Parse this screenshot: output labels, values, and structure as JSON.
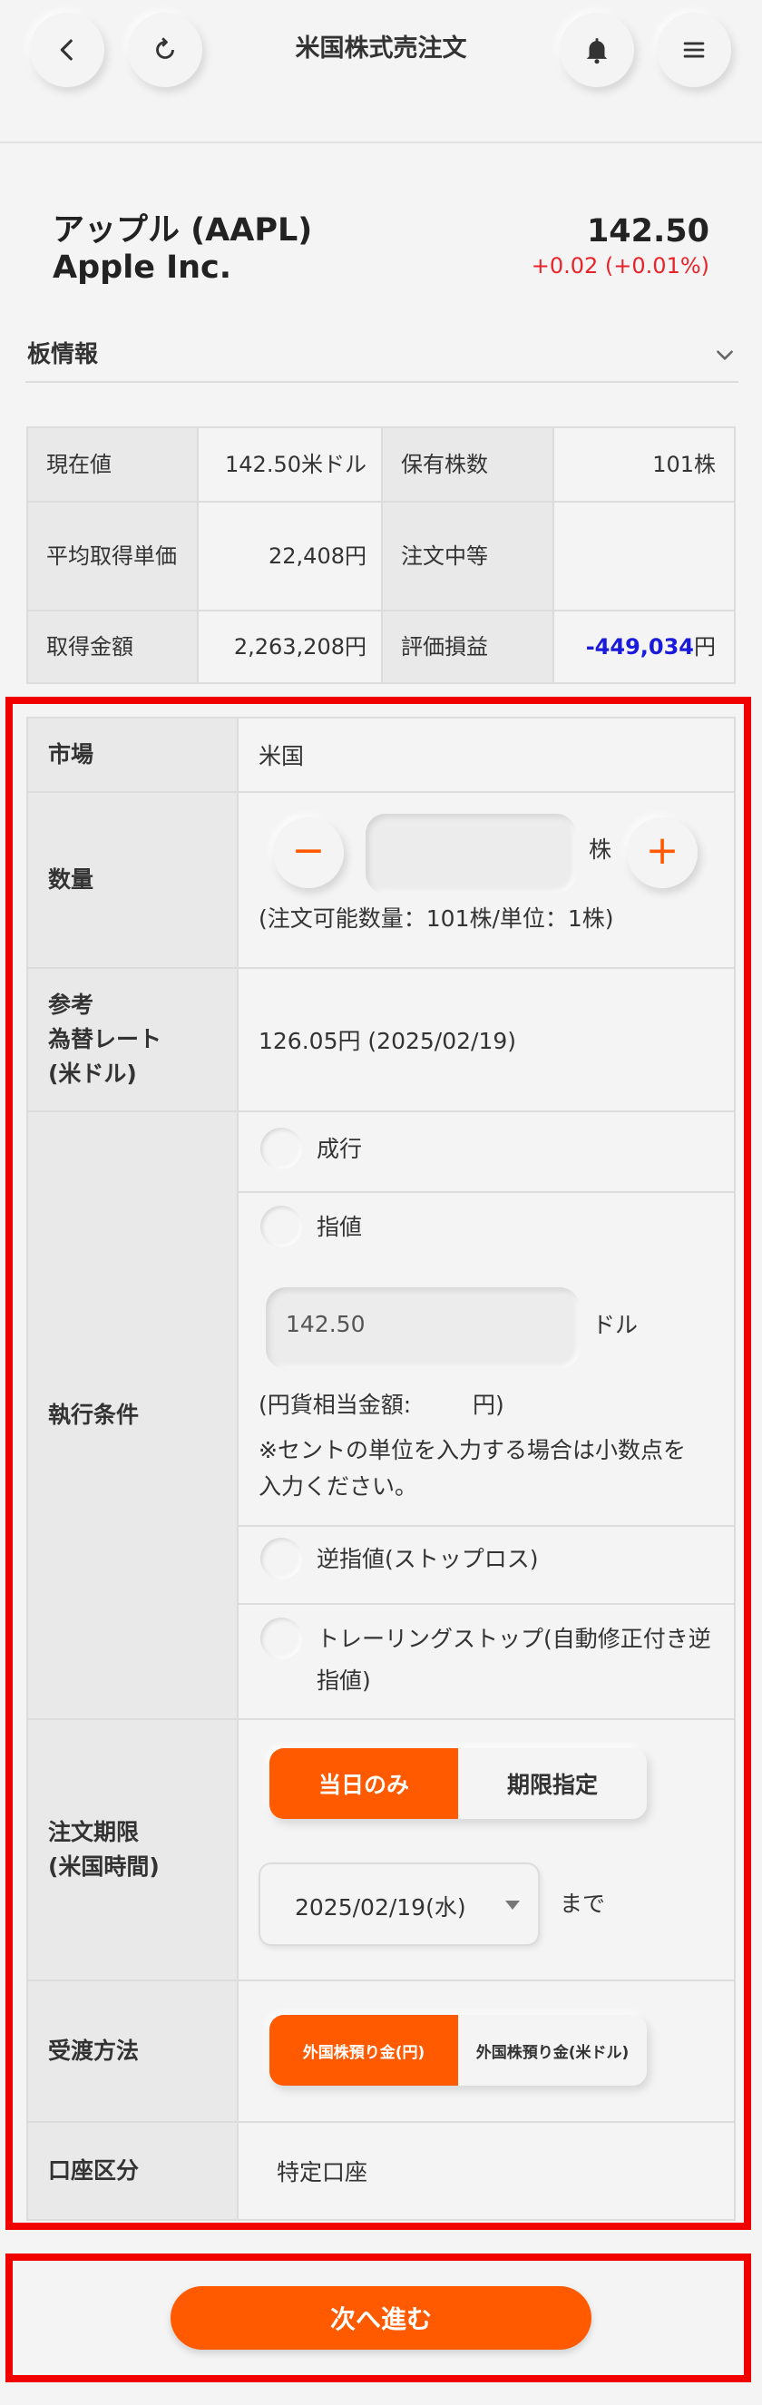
{
  "header": {
    "title": "米国株式売注文",
    "back_icon": "chevron-left-icon",
    "refresh_icon": "refresh-icon",
    "bell_icon": "bell-icon",
    "menu_icon": "hamburger-menu-icon"
  },
  "stock": {
    "name": "アップル (AAPL)",
    "sub": "Apple Inc.",
    "price": "142.50",
    "change": "+0.02",
    "change_pct": "(+0.01%)"
  },
  "board": {
    "label": "板情報"
  },
  "info_table": {
    "rows": [
      {
        "l1": "現在値",
        "v1": "142.50米ドル",
        "l2": "保有株数",
        "v2": "101株"
      },
      {
        "l1": "平均取得単価",
        "v1": "22,408円",
        "l2": "注文中等",
        "v2": ""
      },
      {
        "l1": "取得金額",
        "v1": "2,263,208円",
        "l2": "評価損益",
        "v2_num": "-449,034",
        "v2_unit": "円"
      }
    ]
  },
  "form": {
    "market": {
      "label": "市場",
      "value": "米国"
    },
    "quantity": {
      "label": "数量",
      "minus": "−",
      "plus": "+",
      "unit": "株",
      "value": "",
      "note": "(注文可能数量：101株/単位：1株)"
    },
    "rate": {
      "label_1": "参考",
      "label_2": "為替レート",
      "label_3": "(米ドル)",
      "value": "126.05円 (2025/02/19)"
    },
    "execution": {
      "label": "執行条件",
      "market_order": "成行",
      "limit_order": "指値",
      "limit_price": "142.50",
      "limit_unit": "ドル",
      "yen_label": "(円貨相当金額:",
      "yen_unit": "円)",
      "note_1": "※セントの単位を入力する場合は小数点を",
      "note_2": "入力ください。",
      "stop_order": "逆指値(ストップロス)",
      "trailing_1": "トレーリングストップ(自動修正付き逆",
      "trailing_2": "指値)"
    },
    "period": {
      "label_1": "注文期限",
      "label_2": "(米国時間)",
      "opt_today": "当日のみ",
      "opt_specify": "期限指定",
      "date": "2025/02/19(水)",
      "until": "まで"
    },
    "delivery": {
      "label": "受渡方法",
      "opt_yen": "外国株預り金(円)",
      "opt_usd": "外国株預り金(米ドル)"
    },
    "account": {
      "label": "口座区分",
      "value": "特定口座"
    }
  },
  "footer": {
    "next_label": "次へ進む"
  },
  "colors": {
    "accent": "#ff5a00",
    "highlight": "#f10000",
    "positive": "#e8232a",
    "negative": "#1a1adc"
  }
}
